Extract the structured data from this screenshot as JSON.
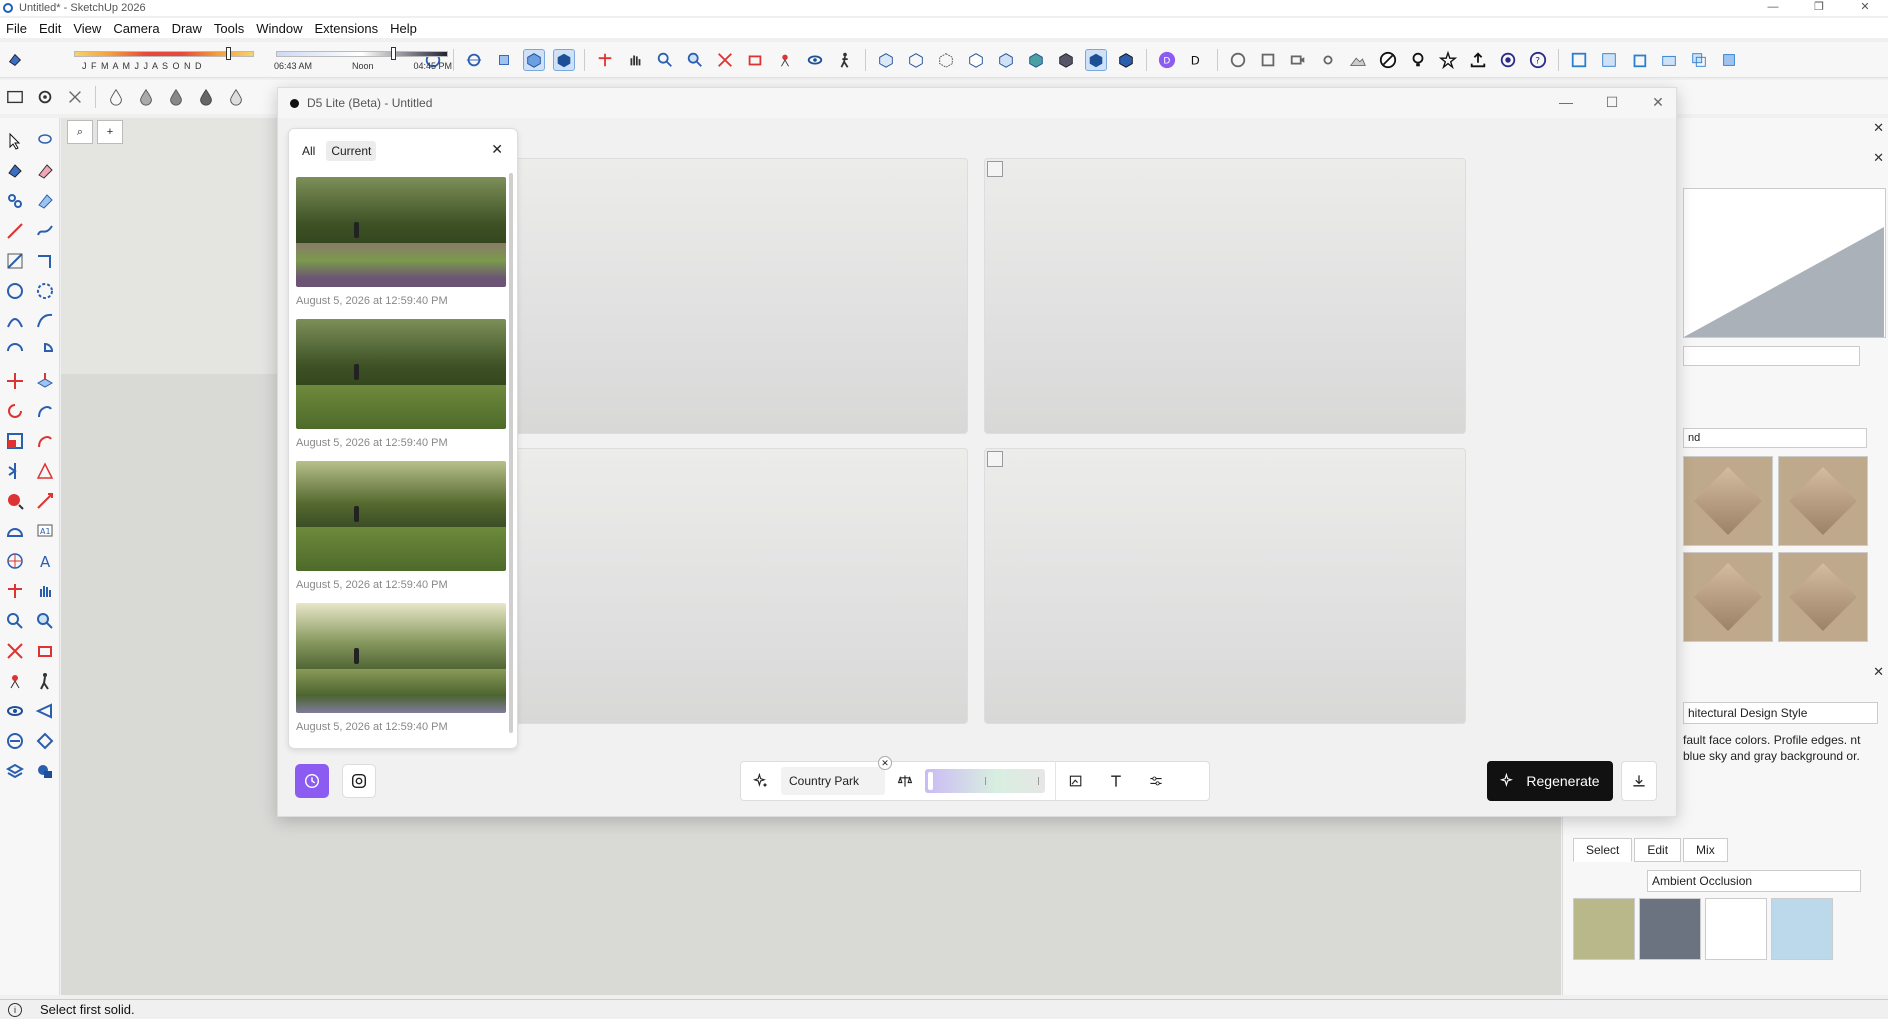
{
  "window": {
    "title": "Untitled* - SketchUp 2026",
    "controls": [
      "—",
      "❐",
      "✕"
    ]
  },
  "menu": [
    "File",
    "Edit",
    "View",
    "Camera",
    "Draw",
    "Tools",
    "Window",
    "Extensions",
    "Help"
  ],
  "shadows": {
    "months": "J F M A M J J A S O N D",
    "time_start": "06:43 AM",
    "time_noon": "Noon",
    "time_end": "04:45 PM"
  },
  "d5": {
    "title": "D5 Lite (Beta) - Untitled",
    "controls": [
      "—",
      "☐",
      "✕"
    ],
    "history": {
      "tab_all": "All",
      "tab_current": "Current",
      "close": "✕",
      "items": [
        {
          "date": "August 5, 2026 at 12:59:40 PM"
        },
        {
          "date": "August 5, 2026 at 12:59:40 PM"
        },
        {
          "date": "August 5, 2026 at 12:59:40 PM"
        },
        {
          "date": "August 5, 2026 at 12:59:40 PM"
        }
      ]
    },
    "prompt": "Country Park",
    "prompt_close": "✕",
    "regenerate": "Regenerate",
    "icons": [
      "history-icon",
      "instagram-icon",
      "sparkle-icon",
      "balance-icon",
      "image-add-icon",
      "text-icon",
      "sliders-icon",
      "download-icon"
    ],
    "accent": "#8c5cf2"
  },
  "right_panel": {
    "close": "✕",
    "material_dropdown": "nd",
    "style_name": "hitectural Design Style",
    "style_desc": "fault face colors. Profile edges. nt blue sky and gray background or.",
    "tabs": [
      "Select",
      "Edit",
      "Mix"
    ],
    "style_dropdown": "Ambient Occlusion"
  },
  "viewport": {
    "search_tool": "⌕",
    "add_tool": "+"
  },
  "status": {
    "text": "Select first solid."
  }
}
